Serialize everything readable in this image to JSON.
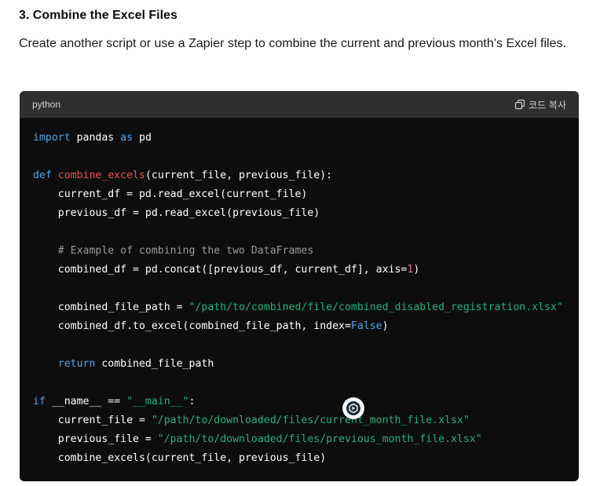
{
  "section": {
    "heading": "3. Combine the Excel Files",
    "description": "Create another script or use a Zapier step to combine the current and previous month’s Excel files."
  },
  "code_block": {
    "language": "python",
    "copy_label": "코드 복사",
    "copy_icon": "copy-icon",
    "lines": [
      [
        {
          "t": "import",
          "c": "kw"
        },
        {
          "t": " pandas "
        },
        {
          "t": "as",
          "c": "kw"
        },
        {
          "t": " pd"
        }
      ],
      [],
      [
        {
          "t": "def",
          "c": "kw"
        },
        {
          "t": " "
        },
        {
          "t": "combine_excels",
          "c": "fn"
        },
        {
          "t": "(current_file, previous_file):"
        }
      ],
      [
        {
          "t": "    current_df = pd.read_excel(current_file)"
        }
      ],
      [
        {
          "t": "    previous_df = pd.read_excel(previous_file)"
        }
      ],
      [],
      [
        {
          "t": "    "
        },
        {
          "t": "# Example of combining the two DataFrames",
          "c": "cmt"
        }
      ],
      [
        {
          "t": "    combined_df = pd.concat([previous_df, current_df], axis="
        },
        {
          "t": "1",
          "c": "num"
        },
        {
          "t": ")"
        }
      ],
      [],
      [
        {
          "t": "    combined_file_path = "
        },
        {
          "t": "\"/path/to/combined/file/combined_disabled_registration.xlsx\"",
          "c": "str"
        }
      ],
      [
        {
          "t": "    combined_df.to_excel(combined_file_path, index="
        },
        {
          "t": "False",
          "c": "kw"
        },
        {
          "t": ")"
        }
      ],
      [],
      [
        {
          "t": "    "
        },
        {
          "t": "return",
          "c": "kw"
        },
        {
          "t": " combined_file_path"
        }
      ],
      [],
      [
        {
          "t": "if",
          "c": "kw"
        },
        {
          "t": " __name__ == "
        },
        {
          "t": "\"__main__\"",
          "c": "str"
        },
        {
          "t": ":"
        }
      ],
      [
        {
          "t": "    current_file = "
        },
        {
          "t": "\"/path/to/downloaded/files/current_month_file.xlsx\"",
          "c": "str"
        }
      ],
      [
        {
          "t": "    previous_file = "
        },
        {
          "t": "\"/path/to/downloaded/files/previous_month_file.xlsx\"",
          "c": "str"
        }
      ],
      [
        {
          "t": "    combine_excels(current_file, previous_file)"
        }
      ]
    ]
  },
  "floating_button": {
    "icon": "assistant-icon"
  }
}
